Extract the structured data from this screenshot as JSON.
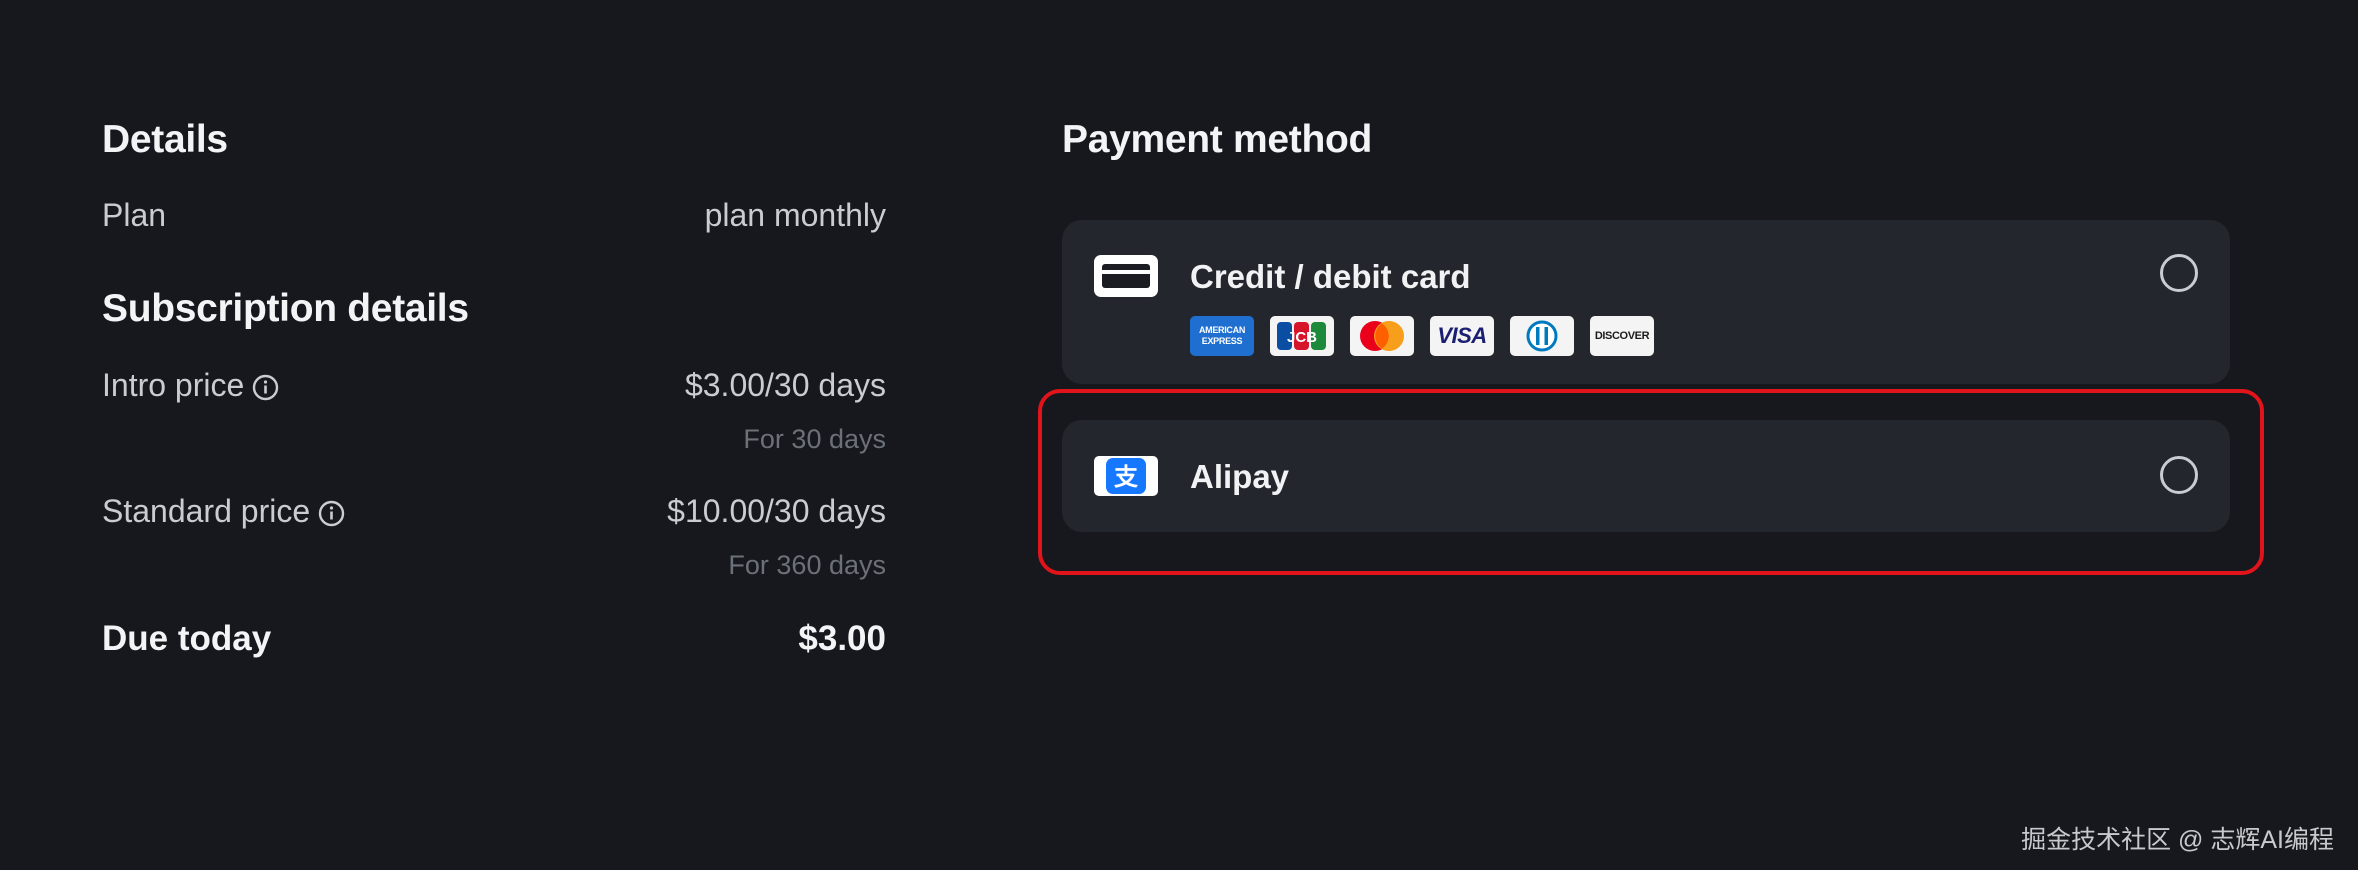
{
  "details": {
    "title": "Details",
    "plan_label": "Plan",
    "plan_value": "plan monthly"
  },
  "subscription": {
    "title": "Subscription details",
    "intro_label": "Intro price",
    "intro_value": "$3.00/30 days",
    "intro_note": "For 30 days",
    "standard_label": "Standard price",
    "standard_value": "$10.00/30 days",
    "standard_note": "For 360 days"
  },
  "due": {
    "label": "Due today",
    "value": "$3.00"
  },
  "payment": {
    "title": "Payment method",
    "methods": [
      {
        "label": "Credit / debit card",
        "icon": "credit-card-icon",
        "brands": [
          "American Express",
          "JCB",
          "Mastercard",
          "VISA",
          "Diners Club",
          "Discover"
        ],
        "selected": false
      },
      {
        "label": "Alipay",
        "icon": "alipay-icon",
        "alipay_glyph": "支",
        "selected": false
      }
    ]
  },
  "brand_text": {
    "amex_line1": "AMERICAN",
    "amex_line2": "EXPRESS",
    "jcb": "JCB",
    "visa": "VISA",
    "discover": "DISCOVER"
  },
  "watermark": "掘金技术社区 @ 志辉AI编程",
  "colors": {
    "background": "#16181d",
    "card": "#23262c",
    "highlight_border": "#e0141a",
    "alipay_blue": "#1677ff"
  }
}
